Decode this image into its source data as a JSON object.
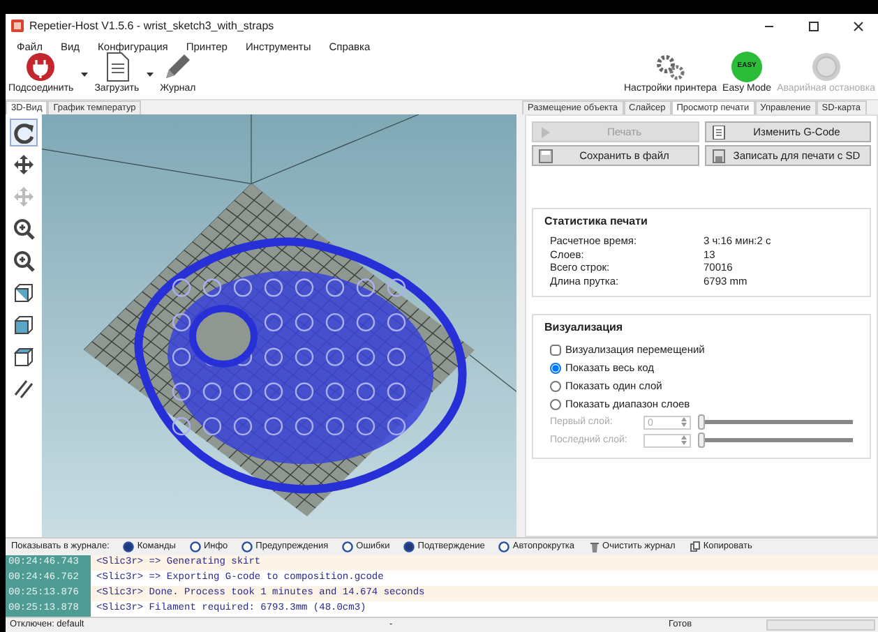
{
  "window": {
    "title": "Repetier-Host V1.5.6 - wrist_sketch3_with_straps"
  },
  "menu": [
    "Файл",
    "Вид",
    "Конфигурация",
    "Принтер",
    "Инструменты",
    "Справка"
  ],
  "toolbar_left": [
    {
      "kind": "connect",
      "label": "Подсоединить",
      "dropdown": true
    },
    {
      "kind": "load",
      "label": "Загрузить",
      "dropdown": true
    },
    {
      "kind": "log",
      "label": "Журнал",
      "dropdown": false
    }
  ],
  "toolbar_right": [
    {
      "kind": "settings",
      "label": "Настройки принтера",
      "disabled": false
    },
    {
      "kind": "easy",
      "label": "Easy Mode",
      "badge": "EASY",
      "disabled": false
    },
    {
      "kind": "stop",
      "label": "Аварийная остановка",
      "disabled": true
    }
  ],
  "left_tabs": [
    {
      "label": "3D-Вид",
      "selected": true
    },
    {
      "label": "График температур",
      "selected": false
    }
  ],
  "view_tools": [
    {
      "kind": "rotate",
      "disabled": false,
      "selected": true
    },
    {
      "kind": "move",
      "disabled": false,
      "selected": false
    },
    {
      "kind": "move-object",
      "disabled": true,
      "selected": false
    },
    {
      "kind": "zoom-in",
      "disabled": false,
      "selected": false
    },
    {
      "kind": "zoom",
      "disabled": false,
      "selected": false
    },
    {
      "kind": "view-iso",
      "disabled": false,
      "selected": false
    },
    {
      "kind": "view-front",
      "disabled": false,
      "selected": false
    },
    {
      "kind": "view-top",
      "disabled": false,
      "selected": false
    },
    {
      "kind": "parallel",
      "disabled": false,
      "selected": false
    }
  ],
  "right_tabs": [
    {
      "label": "Размещение объекта",
      "selected": false
    },
    {
      "label": "Слайсер",
      "selected": false
    },
    {
      "label": "Просмотр печати",
      "selected": true
    },
    {
      "label": "Управление",
      "selected": false
    },
    {
      "label": "SD-карта",
      "selected": false
    }
  ],
  "actions": [
    {
      "kind": "play",
      "label": "Печать",
      "disabled": true
    },
    {
      "kind": "edit",
      "label": "Изменить G-Code",
      "disabled": false
    },
    {
      "kind": "save",
      "label": "Сохранить в файл",
      "disabled": false
    },
    {
      "kind": "sd",
      "label": "Записать для печати с SD",
      "disabled": false
    }
  ],
  "stats": {
    "title": "Статистика печати",
    "rows": [
      {
        "label": "Расчетное время:",
        "value": "3 ч:16 мин:2 с"
      },
      {
        "label": "Слоев:",
        "value": "13"
      },
      {
        "label": "Всего строк:",
        "value": "70016"
      },
      {
        "label": "Длина прутка:",
        "value": "6793 mm"
      }
    ]
  },
  "visualization": {
    "title": "Визуализация",
    "options": [
      {
        "kind": "checkbox",
        "label": "Визуализация перемещений",
        "checked": false
      },
      {
        "kind": "radio",
        "label": "Показать весь код",
        "checked": true
      },
      {
        "kind": "radio",
        "label": "Показать один слой",
        "checked": false
      },
      {
        "kind": "radio",
        "label": "Показать диапазон слоев",
        "checked": false
      }
    ],
    "layers": [
      {
        "label": "Первый слой:",
        "value": "0",
        "level": 0
      },
      {
        "label": "Последний слой:",
        "level": 0
      }
    ]
  },
  "log_filter": {
    "label": "Показывать в журнале:",
    "options": [
      {
        "label": "Команды",
        "checked": true
      },
      {
        "label": "Инфо",
        "checked": false
      },
      {
        "label": "Предупреждения",
        "checked": false
      },
      {
        "label": "Ошибки",
        "checked": false
      },
      {
        "label": "Подтверждение",
        "checked": true
      },
      {
        "label": "Автопрокрутка",
        "checked": false
      }
    ],
    "actions": [
      {
        "kind": "trash",
        "label": "Очистить журнал"
      },
      {
        "kind": "copy",
        "label": "Копировать"
      }
    ]
  },
  "log": [
    {
      "time": "00:24:46.743",
      "text": "<Slic3r> => Generating skirt"
    },
    {
      "time": "00:24:46.762",
      "text": "<Slic3r> => Exporting G-code to composition.gcode"
    },
    {
      "time": "00:25:13.876",
      "text": "<Slic3r> Done. Process took 1 minutes and 14.674 seconds"
    },
    {
      "time": "00:25:13.878",
      "text": "<Slic3r> Filament required: 6793.3mm (48.0cm3)"
    }
  ],
  "status_bar": {
    "connection": "Отключен: default",
    "middle": "-",
    "state": "Готов",
    "progress": {
      "level": 0
    }
  }
}
